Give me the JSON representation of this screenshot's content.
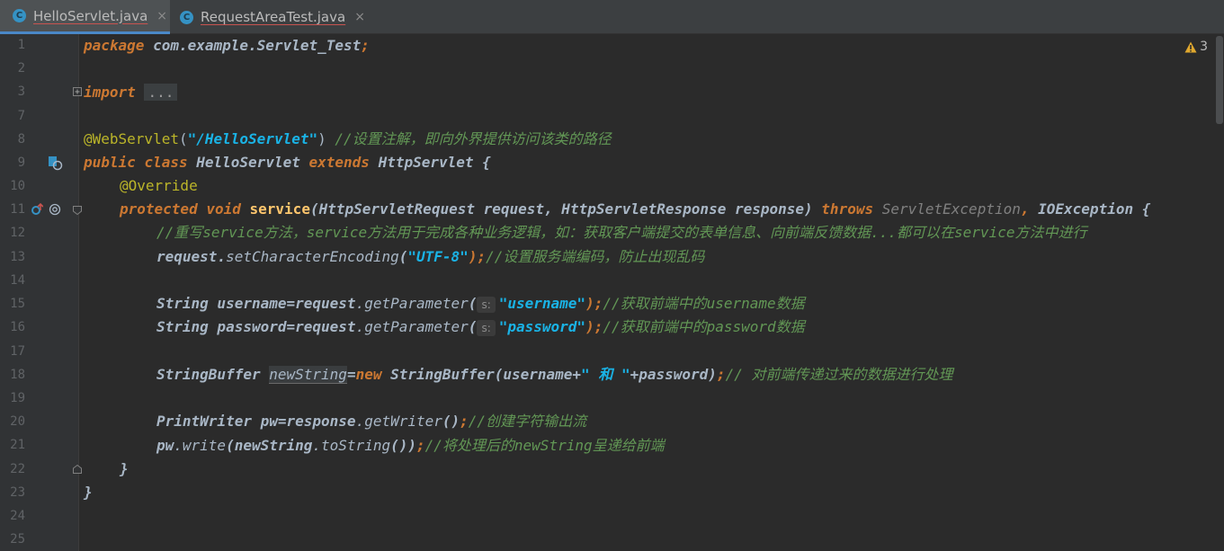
{
  "tabs": [
    {
      "label": "HelloServlet.java",
      "icon": "C",
      "active": true
    },
    {
      "label": "RequestAreaTest.java",
      "icon": "C",
      "active": false
    }
  ],
  "close_glyph": "×",
  "warnings": {
    "count": "3"
  },
  "line_numbers": [
    "1",
    "2",
    "3",
    "7",
    "8",
    "9",
    "10",
    "11",
    "12",
    "13",
    "14",
    "15",
    "16",
    "17",
    "18",
    "19",
    "20",
    "21",
    "22",
    "23",
    "24",
    "25"
  ],
  "code": {
    "l1_kw": "package",
    "l1_rest": " com.example.Servlet_Test",
    "l1_semi": ";",
    "l3_kw": "import",
    "l3_dots": "...",
    "l8_ann": "@WebServlet",
    "l8_open": "(",
    "l8_str": "\"/HelloServlet\"",
    "l8_close": ")",
    "l8_cmt": " //设置注解，即向外界提供访问该类的路径",
    "l9_kw1": "public",
    "l9_kw2": "class",
    "l9_cls": "HelloServlet",
    "l9_kw3": "extends",
    "l9_cls2": "HttpServlet",
    "l9_brace": " {",
    "l10_ann": "@Override",
    "l11_kw1": "protected",
    "l11_kw2": "void",
    "l11_mth": "service",
    "l11_params": "(HttpServletRequest request, HttpServletResponse response) ",
    "l11_throws": "throws",
    "l11_ex1": " ServletException",
    "l11_comma": ",",
    "l11_ex2": " IOException",
    "l11_brace": " {",
    "l12_cmt": "//重写service方法，service方法用于完成各种业务逻辑，如：获取客户端提交的表单信息、向前端反馈数据...都可以在service方法中进行",
    "l13_obj": "request",
    "l13_dot": ".",
    "l13_mth": "setCharacterEncoding",
    "l13_open": "(",
    "l13_str": "\"UTF-8\"",
    "l13_close": ");",
    "l13_cmt": "//设置服务端编码，防止出现乱码",
    "l15_decl": "String username=request",
    "l15_mth": ".getParameter",
    "l15_open": "(",
    "l15_hint": "s:",
    "l15_str": "\"username\"",
    "l15_close": ");",
    "l15_cmt": "//获取前端中的username数据",
    "l16_decl": "String password=request",
    "l16_mth": ".getParameter",
    "l16_open": "(",
    "l16_hint": "s:",
    "l16_str": "\"password\"",
    "l16_close": ");",
    "l16_cmt": "//获取前端中的password数据",
    "l18_type": "StringBuffer ",
    "l18_var": "newString",
    "l18_eq": "=",
    "l18_new": "new",
    "l18_cls": " StringBuffer",
    "l18_args1": "(username+",
    "l18_str": "\" 和 \"",
    "l18_args2": "+password)",
    "l18_semi": ";",
    "l18_cmt": "// 对前端传递过来的数据进行处理",
    "l20_decl": "PrintWriter pw=response",
    "l20_mth": ".getWriter",
    "l20_call": "()",
    "l20_semi": ";",
    "l20_cmt": "//创建字符输出流",
    "l21_obj": "pw",
    "l21_mth": ".write",
    "l21_args": "(newString",
    "l21_mth2": ".toString",
    "l21_close": "())",
    "l21_semi": ";",
    "l21_cmt": "//将处理后的newString呈递给前端",
    "l22": "}",
    "l23": "}"
  },
  "colors": {
    "background": "#2b2b2b",
    "keyword": "#cc7832",
    "string": "#1ab3e6",
    "comment": "#629755",
    "annotation": "#bbb529",
    "method": "#ffc66d"
  }
}
